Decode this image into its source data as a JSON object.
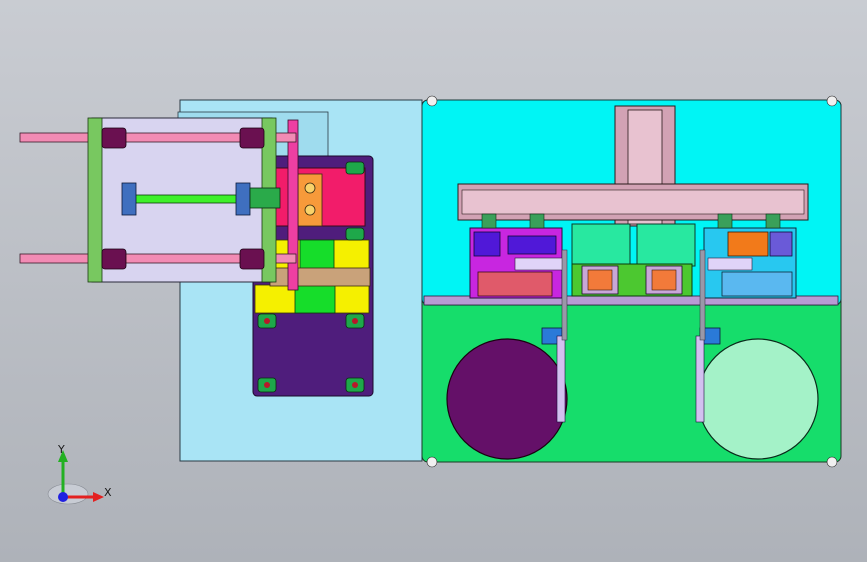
{
  "window": {
    "viewport_label": "",
    "background_top": "#c9ccd2",
    "background_bottom": "#aeb2b9"
  },
  "triad": {
    "x_label": "X",
    "y_label": "Y",
    "x_color": "#e32020",
    "y_color": "#22b022",
    "z_color": "#2020e0"
  },
  "colors": {
    "base_left": "#a9e4f5",
    "base_right": "#16dd6b",
    "top_right": "#00f5f5",
    "roller_dark": "#641068",
    "roller_light": "#a4f2c8",
    "plate_purple": "#4f1d7c",
    "rail_pink": "#f28bb4",
    "frame_lavender": "#d8d4f0",
    "frame_green": "#78c860"
  }
}
